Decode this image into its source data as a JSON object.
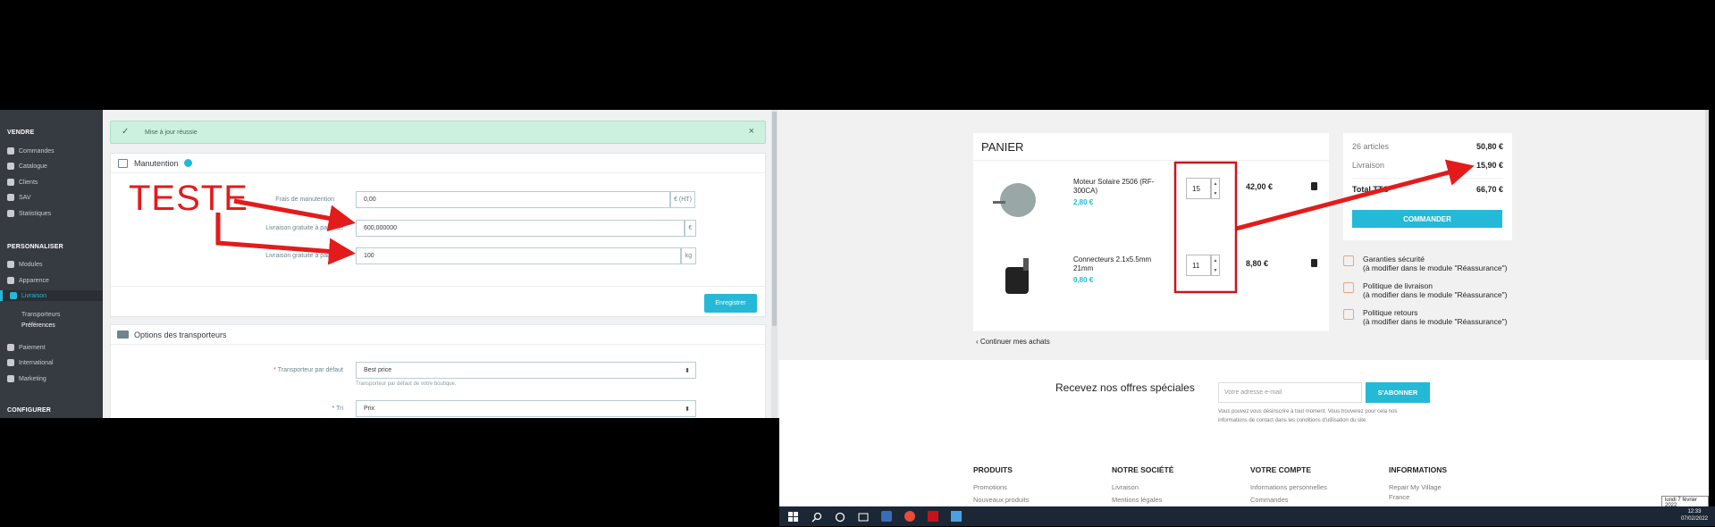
{
  "admin": {
    "sidebar": {
      "sections": [
        "VENDRE",
        "PERSONNALISER",
        "CONFIGURER"
      ],
      "items": [
        {
          "label": "Commandes",
          "icon": "inbox-icon"
        },
        {
          "label": "Catalogue",
          "icon": "store-icon"
        },
        {
          "label": "Clients",
          "icon": "account-icon"
        },
        {
          "label": "SAV",
          "icon": "chat-icon"
        },
        {
          "label": "Statistiques",
          "icon": "chart-icon"
        },
        {
          "label": "Modules",
          "icon": "puzzle-icon"
        },
        {
          "label": "Apparence",
          "icon": "desktop-icon"
        },
        {
          "label": "Livraison",
          "icon": "truck-icon"
        },
        {
          "label": "Paiement",
          "icon": "card-icon"
        },
        {
          "label": "International",
          "icon": "globe-icon"
        },
        {
          "label": "Marketing",
          "icon": "megaphone-icon"
        }
      ],
      "subitems": [
        "Transporteurs",
        "Préférences"
      ]
    },
    "alert": "Mise à jour réussie",
    "handling": {
      "title": "Manutention",
      "fields": [
        {
          "label": "Frais de manutention",
          "value": "0,00",
          "addon": "€ (HT)"
        },
        {
          "label": "Livraison gratuite à partir de",
          "value": "600,000000",
          "addon": "€"
        },
        {
          "label": "Livraison gratuite à partir de",
          "value": "100",
          "addon": "kg"
        }
      ],
      "save": "Enregistrer"
    },
    "carriers": {
      "title": "Options des transporteurs",
      "default_label": "Transporteur par défaut",
      "default_value": "Best price",
      "default_help": "Transporteur par défaut de votre boutique.",
      "sort_label": "Tri",
      "sort_value": "Prix"
    }
  },
  "annotation": {
    "text": "TESTE",
    "color": "#e31b1b"
  },
  "shop": {
    "cart": {
      "title": "PANIER",
      "items": [
        {
          "name": "Moteur Solaire 2506 (RF-300CA)",
          "price": "2,80 €",
          "qty": "15",
          "total": "42,00 €"
        },
        {
          "name": "Connecteurs 2.1x5.5mm 21mm",
          "price": "0,80 €",
          "qty": "11",
          "total": "8,80 €"
        }
      ],
      "continue": "Continuer mes achats"
    },
    "summary": {
      "articles_label": "26 articles",
      "articles_value": "50,80 €",
      "shipping_label": "Livraison",
      "shipping_value": "15,90 €",
      "total_label": "Total TTC",
      "total_value": "66,70 €",
      "order_button": "COMMANDER"
    },
    "reassurance": [
      {
        "title": "Garanties sécurité",
        "note": "(à modifier dans le module \"Réassurance\")"
      },
      {
        "title": "Politique de livraison",
        "note": "(à modifier dans le module \"Réassurance\")"
      },
      {
        "title": "Politique retours",
        "note": "(à modifier dans le module \"Réassurance\")"
      }
    ],
    "newsletter": {
      "title": "Recevez nos offres spéciales",
      "placeholder": "Votre adresse e-mail",
      "button": "S'ABONNER",
      "note1": "Vous pouvez vous désinscrire à tout moment. Vous trouverez pour cela nos",
      "note2": "informations de contact dans les conditions d'utilisation du site."
    },
    "footer": {
      "columns": [
        {
          "title": "PRODUITS",
          "items": [
            "Promotions",
            "Nouveaux produits"
          ]
        },
        {
          "title": "NOTRE SOCIÉTÉ",
          "items": [
            "Livraison",
            "Mentions légales"
          ]
        },
        {
          "title": "VOTRE COMPTE",
          "items": [
            "Informations personnelles",
            "Commandes"
          ]
        },
        {
          "title": "INFORMATIONS",
          "items": [
            "Repair My Village",
            "France"
          ]
        }
      ]
    }
  },
  "taskbar": {
    "date_tooltip": "lundi 7 février 2022",
    "time": "12:33",
    "date": "07/02/2022"
  }
}
